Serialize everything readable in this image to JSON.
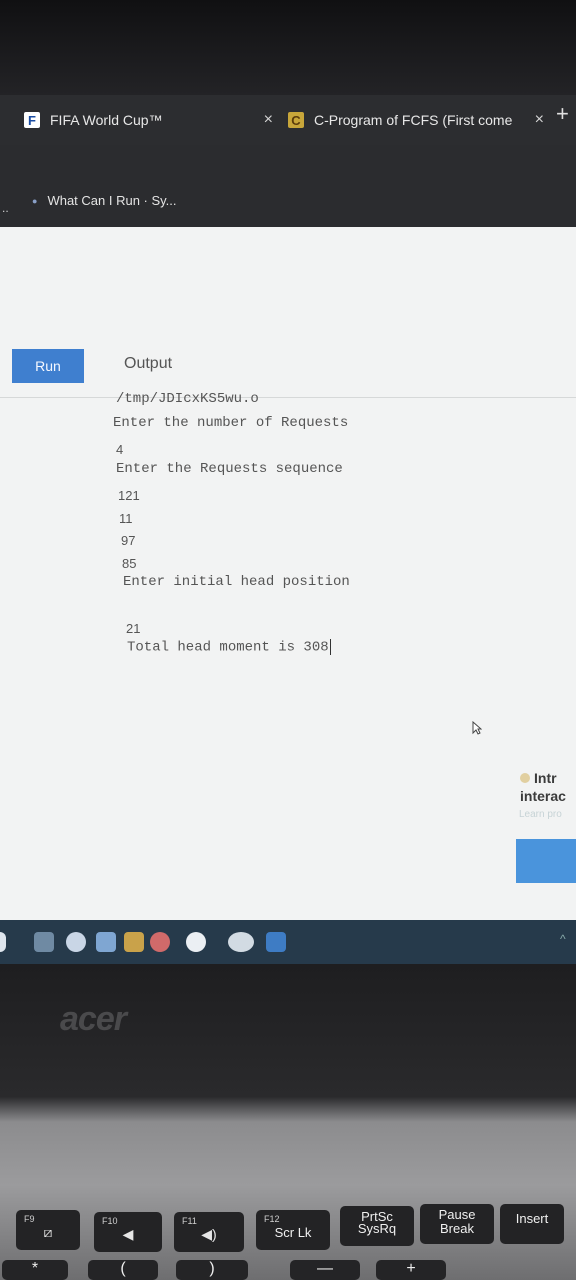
{
  "browser": {
    "tabs": [
      {
        "label": "FIFA World Cup™",
        "favicon": "F",
        "close": "×"
      },
      {
        "label": "C-Program of FCFS (First come",
        "favicon": "C",
        "close": "×"
      }
    ],
    "new_tab": "+",
    "bookmarks_overflow": "..",
    "bookmark": "What Can I Run · Sy..."
  },
  "editor": {
    "run_label": "Run",
    "output_title": "Output",
    "output_lines": [
      "/tmp/JDIcxKS5wu.o",
      "Enter the number of Requests",
      "4",
      "Enter the Requests sequence",
      "121",
      "11",
      "97",
      "85",
      "Enter initial head position",
      "21",
      "Total head moment is 308"
    ]
  },
  "side_panel": {
    "line1": "Intr",
    "line2": "interac",
    "line3": "Learn pro"
  },
  "laptop": {
    "brand": "acer",
    "keys": [
      {
        "fn": "F9",
        "icon": "touchpad-off-icon"
      },
      {
        "fn": "F10",
        "icon": "volume-down-icon"
      },
      {
        "fn": "F11",
        "icon": "volume-up-icon"
      },
      {
        "fn": "F12",
        "label": "Scr Lk"
      },
      {
        "top": "PrtSc",
        "bottom": "SysRq"
      },
      {
        "top": "Pause",
        "bottom": "Break"
      },
      {
        "label": "Insert"
      }
    ],
    "lower_keys": [
      "*",
      "(",
      ")",
      "—",
      "+"
    ]
  },
  "colors": {
    "run_button": "#3f7fcf",
    "taskbar": "#263a4b",
    "page_bg": "#f2f3f3"
  }
}
